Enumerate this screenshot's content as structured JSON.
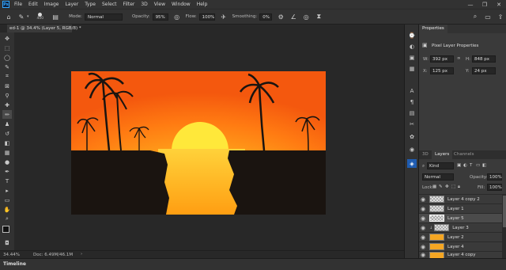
{
  "app": {
    "logo": "Ps"
  },
  "menu": [
    "File",
    "Edit",
    "Image",
    "Layer",
    "Type",
    "Select",
    "Filter",
    "3D",
    "View",
    "Window",
    "Help"
  ],
  "window_controls": {
    "minimize": "—",
    "maximize": "❐",
    "close": "✕"
  },
  "options_bar": {
    "brush_size": "400",
    "mode_label": "Mode:",
    "mode_value": "Normal",
    "opacity_label": "Opacity:",
    "opacity_value": "95%",
    "flow_label": "Flow:",
    "flow_value": "100%",
    "smoothing_label": "Smoothing:",
    "smoothing_value": "0%"
  },
  "document_tab": {
    "title": "ed-1 @ 34.4% (Layer 5, RGB/8) *"
  },
  "status": {
    "zoom": "34.44%",
    "doc_size": "Doc: 6.49M/46.1M"
  },
  "timeline": {
    "label": "Timeline"
  },
  "properties": {
    "tab": "Properties",
    "section": "Pixel Layer Properties",
    "w_label": "W:",
    "w_value": "392 px",
    "h_label": "H:",
    "h_value": "848 px",
    "x_label": "X:",
    "x_value": "125 px",
    "y_label": "Y:",
    "y_value": "24 px"
  },
  "layers_panel": {
    "tabs": [
      "3D",
      "Layers",
      "Channels"
    ],
    "active_tab": "Layers",
    "filter_label": "Kind",
    "blend_mode": "Normal",
    "opacity_label": "Opacity:",
    "opacity_value": "100%",
    "lock_label": "Lock:",
    "fill_label": "Fill:",
    "fill_value": "100%",
    "layers": [
      {
        "name": "Layer 4 copy 2",
        "selected": false,
        "thumb": "transparent"
      },
      {
        "name": "Layer 1",
        "selected": false,
        "thumb": "transparent"
      },
      {
        "name": "Layer 5",
        "selected": true,
        "thumb": "transparent"
      },
      {
        "name": "Layer 3",
        "selected": false,
        "thumb": "transparent"
      },
      {
        "name": "Layer 2",
        "selected": false,
        "thumb": "orange"
      },
      {
        "name": "Layer 4",
        "selected": false,
        "thumb": "orange"
      },
      {
        "name": "Layer 4 copy",
        "selected": false,
        "thumb": "orange"
      }
    ]
  },
  "colors": {
    "accent": "#31a8ff",
    "panel": "#323232",
    "background": "#282828"
  }
}
